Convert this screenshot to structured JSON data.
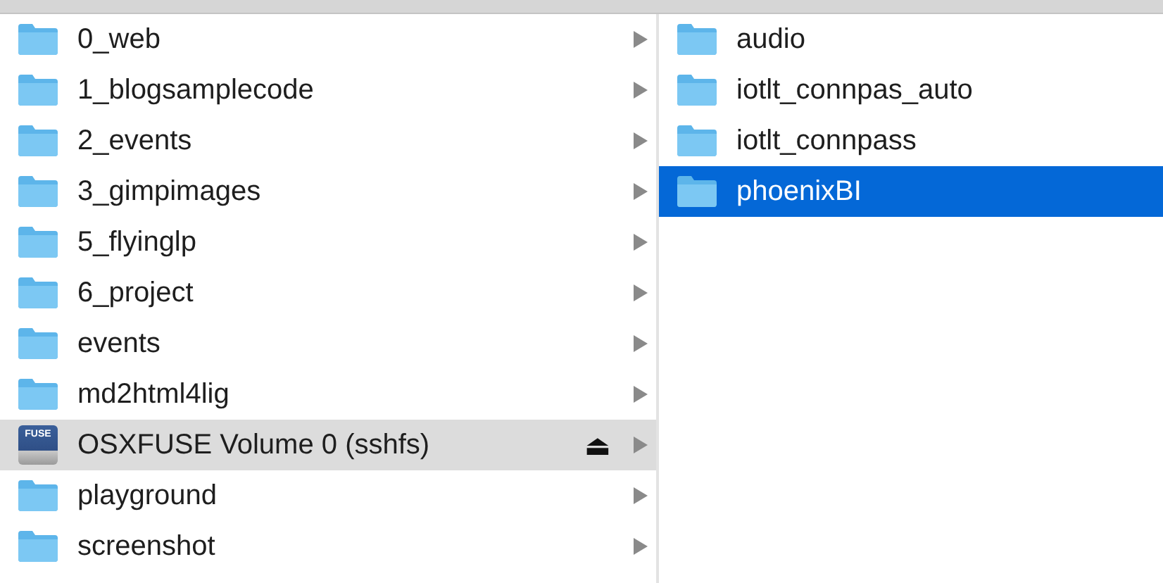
{
  "columns": [
    {
      "active": false,
      "items": [
        {
          "kind": "folder",
          "name": "0_web",
          "selected": false,
          "has_children": true
        },
        {
          "kind": "folder",
          "name": "1_blogsamplecode",
          "selected": false,
          "has_children": true
        },
        {
          "kind": "folder",
          "name": "2_events",
          "selected": false,
          "has_children": true
        },
        {
          "kind": "folder",
          "name": "3_gimpimages",
          "selected": false,
          "has_children": true
        },
        {
          "kind": "folder",
          "name": "5_flyinglp",
          "selected": false,
          "has_children": true
        },
        {
          "kind": "folder",
          "name": "6_project",
          "selected": false,
          "has_children": true
        },
        {
          "kind": "folder",
          "name": "events",
          "selected": false,
          "has_children": true
        },
        {
          "kind": "folder",
          "name": "md2html4lig",
          "selected": false,
          "has_children": true
        },
        {
          "kind": "volume",
          "name": "OSXFUSE Volume 0 (sshfs)",
          "icon_label": "FUSE",
          "selected": true,
          "has_children": true,
          "ejectable": true,
          "eject_symbol": "⏏"
        },
        {
          "kind": "folder",
          "name": "playground",
          "selected": false,
          "has_children": true
        },
        {
          "kind": "folder",
          "name": "screenshot",
          "selected": false,
          "has_children": true
        }
      ]
    },
    {
      "active": true,
      "items": [
        {
          "kind": "folder",
          "name": "audio",
          "selected": false,
          "has_children": false
        },
        {
          "kind": "folder",
          "name": "iotlt_connpas_auto",
          "selected": false,
          "has_children": false
        },
        {
          "kind": "folder",
          "name": "iotlt_connpass",
          "selected": false,
          "has_children": false
        },
        {
          "kind": "folder",
          "name": "phoenixBI",
          "selected": true,
          "has_children": false
        }
      ]
    }
  ]
}
